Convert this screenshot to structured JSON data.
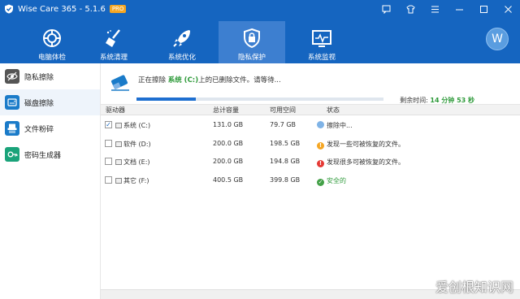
{
  "app": {
    "title": "Wise Care 365 - 5.1.6",
    "badge": "PRO",
    "accent": "#1565c0"
  },
  "window_controls": [
    {
      "name": "feedback-icon",
      "glyph": "⌨"
    },
    {
      "name": "shirt-icon",
      "glyph": "👕"
    },
    {
      "name": "menu-icon",
      "glyph": "☰"
    },
    {
      "name": "minimize-icon",
      "glyph": "—"
    },
    {
      "name": "maximize-icon",
      "glyph": "☐"
    },
    {
      "name": "close-icon",
      "glyph": "✕"
    }
  ],
  "toolbar": {
    "items": [
      {
        "label": "电脑体检",
        "icon": "pc-checkup-icon"
      },
      {
        "label": "系统清理",
        "icon": "broom-icon"
      },
      {
        "label": "系统优化",
        "icon": "rocket-icon"
      },
      {
        "label": "隐私保护",
        "icon": "shield-lock-icon",
        "active": true
      },
      {
        "label": "系统监视",
        "icon": "monitor-icon"
      }
    ],
    "avatar": "W"
  },
  "sidebar": {
    "items": [
      {
        "label": "隐私擦除",
        "icon": "eye-icon",
        "color": "#555555"
      },
      {
        "label": "磁盘擦除",
        "icon": "disk-icon",
        "color": "#1a7bc9",
        "active": true
      },
      {
        "label": "文件粉碎",
        "icon": "shredder-icon",
        "color": "#1a7bc9"
      },
      {
        "label": "密码生成器",
        "icon": "key-icon",
        "color": "#1aa37a"
      }
    ]
  },
  "progress": {
    "prefix": "正在擦除",
    "drive": "系统 (C:)",
    "suffix": "上的已删除文件。请等待...",
    "fraction": 0.24,
    "remaining_label": "剩余时间:",
    "remaining_value": "14 分钟 53 秒"
  },
  "table": {
    "headers": [
      "驱动器",
      "总计容量",
      "可用空间",
      "状态"
    ],
    "rows": [
      {
        "checked": true,
        "drive": "系统 (C:)",
        "total": "131.0 GB",
        "free": "79.7 GB",
        "status": "擦除中...",
        "status_color": "#333333",
        "status_icon": "spinner-icon",
        "icon_color": "#7fb3e6"
      },
      {
        "checked": false,
        "drive": "软件 (D:)",
        "total": "200.0 GB",
        "free": "198.5 GB",
        "status": "发现一些可被恢复的文件。",
        "status_color": "#333333",
        "status_icon": "warning-icon",
        "icon_color": "#f5a623"
      },
      {
        "checked": false,
        "drive": "文档 (E:)",
        "total": "200.0 GB",
        "free": "194.8 GB",
        "status": "发现很多可被恢复的文件。",
        "status_color": "#333333",
        "status_icon": "error-icon",
        "icon_color": "#e53935"
      },
      {
        "checked": false,
        "drive": "其它 (F:)",
        "total": "400.5 GB",
        "free": "399.8 GB",
        "status": "安全的",
        "status_color": "#2e9a3a",
        "status_icon": "check-icon",
        "icon_color": "#43a047"
      }
    ]
  },
  "watermark": "爱创根知识网"
}
